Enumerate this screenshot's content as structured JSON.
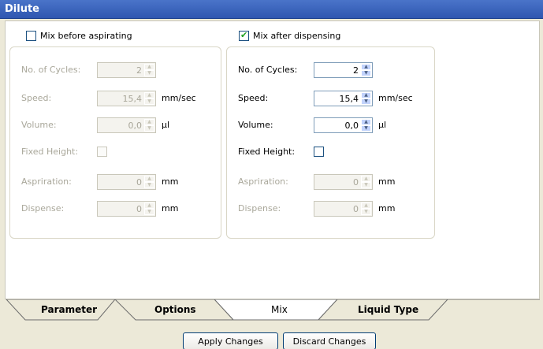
{
  "window": {
    "title": "Dilute"
  },
  "mix_before": {
    "checkbox_label": "Mix before aspirating",
    "checked": false,
    "enabled": false,
    "fields": {
      "cycles": {
        "label": "No. of Cycles:",
        "value": "2",
        "unit": ""
      },
      "speed": {
        "label": "Speed:",
        "value": "15,4",
        "unit": "mm/sec"
      },
      "volume": {
        "label": "Volume:",
        "value": "0,0",
        "unit": "µl"
      },
      "fixed_height": {
        "label": "Fixed Height:"
      },
      "aspiration": {
        "label": "Aspriration:",
        "value": "0",
        "unit": "mm"
      },
      "dispense": {
        "label": "Dispense:",
        "value": "0",
        "unit": "mm"
      }
    }
  },
  "mix_after": {
    "checkbox_label": "Mix after dispensing",
    "checked": true,
    "enabled": true,
    "fields": {
      "cycles": {
        "label": "No. of Cycles:",
        "value": "2",
        "unit": ""
      },
      "speed": {
        "label": "Speed:",
        "value": "15,4",
        "unit": "mm/sec"
      },
      "volume": {
        "label": "Volume:",
        "value": "0,0",
        "unit": "µl"
      },
      "fixed_height": {
        "label": "Fixed Height:"
      },
      "aspiration": {
        "label": "Aspriration:",
        "value": "0",
        "unit": "mm"
      },
      "dispense": {
        "label": "Dispense:",
        "value": "0",
        "unit": "mm"
      }
    }
  },
  "tabs": [
    {
      "label": "Parameter",
      "active": false
    },
    {
      "label": "Options",
      "active": false
    },
    {
      "label": "Mix",
      "active": true
    },
    {
      "label": "Liquid Type",
      "active": false
    }
  ],
  "footer": {
    "apply_label": "Apply Changes",
    "discard_label": "Discard Changes"
  }
}
